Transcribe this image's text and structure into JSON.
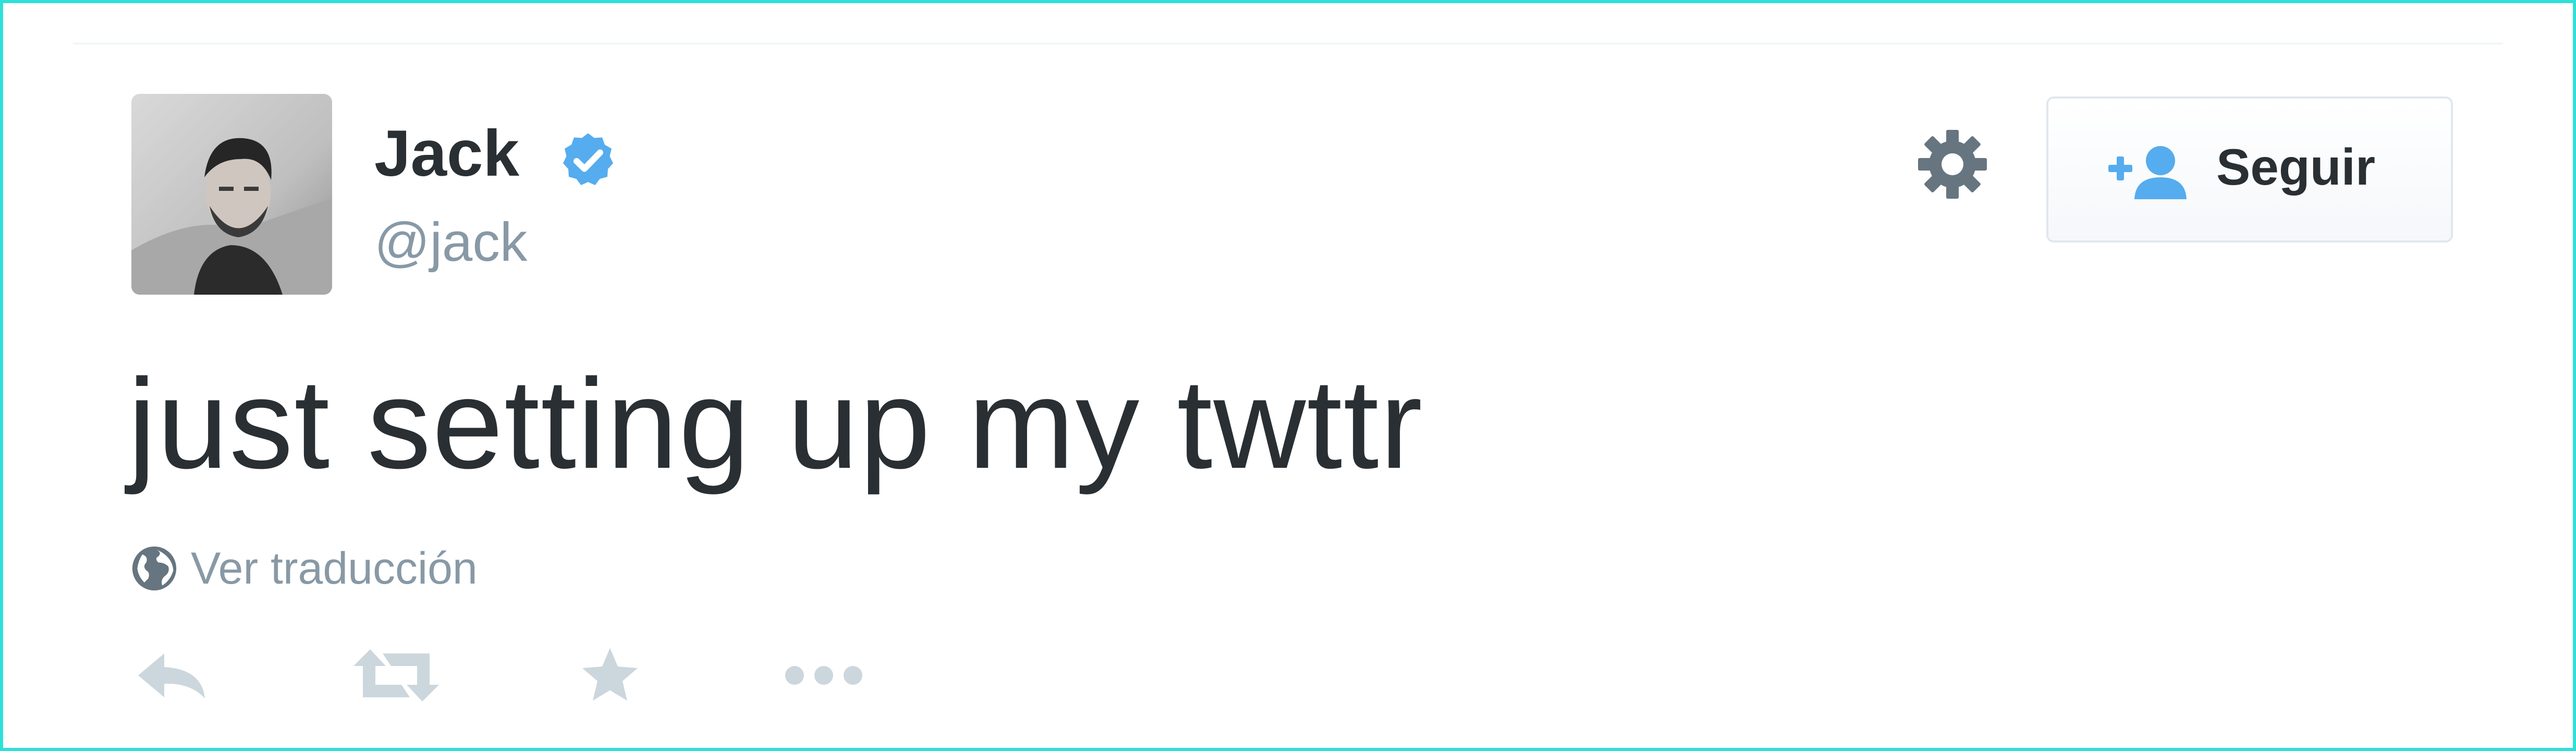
{
  "tweet": {
    "author": {
      "display_name": "Jack",
      "handle": "@jack",
      "verified": true,
      "avatar": "avatar-photo"
    },
    "text": "just setting up my twttr",
    "translate_label": "Ver traducción",
    "follow_label": "Seguir",
    "icons": {
      "settings": "gear-icon",
      "follow": "follow-user-icon",
      "translate": "globe-icon",
      "reply": "reply-icon",
      "retweet": "retweet-icon",
      "favorite": "star-icon",
      "more": "more-icon"
    }
  },
  "colors": {
    "text": "#292f33",
    "muted": "#8899a6",
    "verified": "#55acee",
    "accent_border": "#2ee0d8",
    "action_icon": "#ccd6dd"
  }
}
